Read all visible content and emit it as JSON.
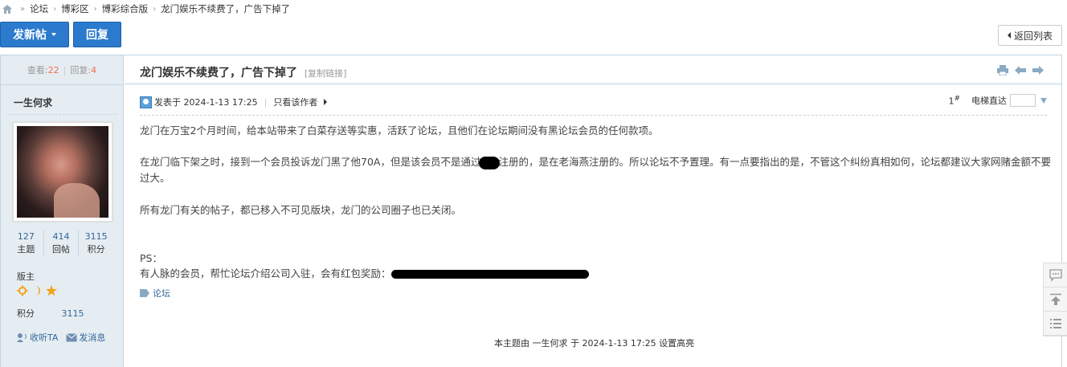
{
  "breadcrumb": {
    "items": [
      "论坛",
      "博彩区",
      "博彩综合版",
      "龙门娱乐不续费了，广告下掉了"
    ],
    "separator": "»"
  },
  "actions": {
    "new_post": "发新帖",
    "reply": "回复",
    "back_to_list": "返回列表"
  },
  "thread_stats": {
    "views_label": "查看:",
    "views": "22",
    "replies_label": "回复:",
    "replies": "4"
  },
  "author": {
    "name": "一生何求",
    "topics": "127",
    "topics_label": "主题",
    "posts": "414",
    "posts_label": "回帖",
    "credits": "3115",
    "credits_label": "积分",
    "role": "版主",
    "score_label": "积分",
    "score": "3115",
    "follow_label": "收听TA",
    "message_label": "发消息"
  },
  "post": {
    "title": "龙门娱乐不续费了，广告下掉了",
    "copy_link": "[复制链接]",
    "posted_label": "发表于 2024-1-13 17:25",
    "only_author": "只看该作者",
    "floor_number": "1",
    "floor_mark": "#",
    "jump_label": "电梯直达",
    "para1": "龙门在万宝2个月时间，给本站带来了白菜存送等实惠，活跃了论坛，且他们在论坛期间没有黑论坛会员的任何款项。",
    "para2a": "在龙门临下架之时，接到一个会员投诉龙门黑了他70A，但是该会员不是通过",
    "para2b": "注册的，是在老海燕注册的。所以论坛不予置理。有一点要指出的是，不管这个纠纷真相如何，论坛都建议大家网赌金额不要过大。",
    "para3": "所有龙门有关的帖子，都已移入不可见版块，龙门的公司圈子也已关闭。",
    "ps": "PS：",
    "ps_text": "有人脉的会员，帮忙论坛介绍公司入驻，会有红包奖励：",
    "tag": "论坛",
    "footnote": "本主题由 一生何求 于 2024-1-13 17:25 设置高亮"
  },
  "colors": {
    "accent": "#2b7acd",
    "sidebar_bg": "#e5edf2",
    "border": "#c2d5e3",
    "highlight_num": "#f26c4f",
    "link": "#336699"
  }
}
